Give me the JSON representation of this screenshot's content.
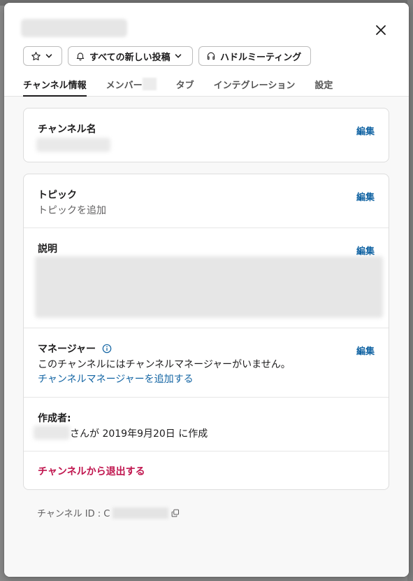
{
  "header": {
    "notifications_label": "すべての新しい投稿",
    "huddle_label": "ハドルミーティング"
  },
  "tabs": [
    {
      "label": "チャンネル情報",
      "active": true
    },
    {
      "label": "メンバー"
    },
    {
      "label": "タブ"
    },
    {
      "label": "インテグレーション"
    },
    {
      "label": "設定"
    }
  ],
  "channel_name": {
    "label": "チャンネル名",
    "edit_label": "編集"
  },
  "topic": {
    "label": "トピック",
    "placeholder": "トピックを追加",
    "edit_label": "編集"
  },
  "description": {
    "label": "説明",
    "edit_label": "編集"
  },
  "managers": {
    "label": "マネージャー",
    "text": "このチャンネルにはチャンネルマネージャーがいません。",
    "add_link": "チャンネルマネージャーを追加する",
    "edit_label": "編集"
  },
  "creator": {
    "label": "作成者:",
    "text": "さんが 2019年9月20日 に作成"
  },
  "leave": {
    "label": "チャンネルから退出する"
  },
  "footer": {
    "channel_id_label": "チャンネル ID : C"
  },
  "colors": {
    "link": "#1264a3",
    "danger": "#c0154e",
    "text": "#1d1c1d"
  }
}
